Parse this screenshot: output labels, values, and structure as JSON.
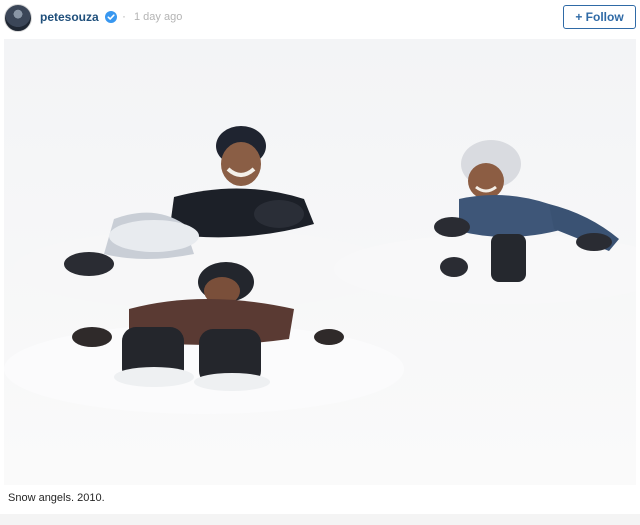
{
  "post": {
    "username": "petesouza",
    "separator": "·",
    "timestamp": "1 day ago",
    "follow_label": "+ Follow",
    "caption": "Snow angels. 2010."
  },
  "icons": {
    "avatar": "avatar-photo",
    "verified": "verified-badge-icon"
  },
  "colors": {
    "username": "#1f4f7b",
    "follow_accent": "#2f6aa6",
    "verified_badge": "#3897f0",
    "muted_text": "#b4b4b4"
  }
}
